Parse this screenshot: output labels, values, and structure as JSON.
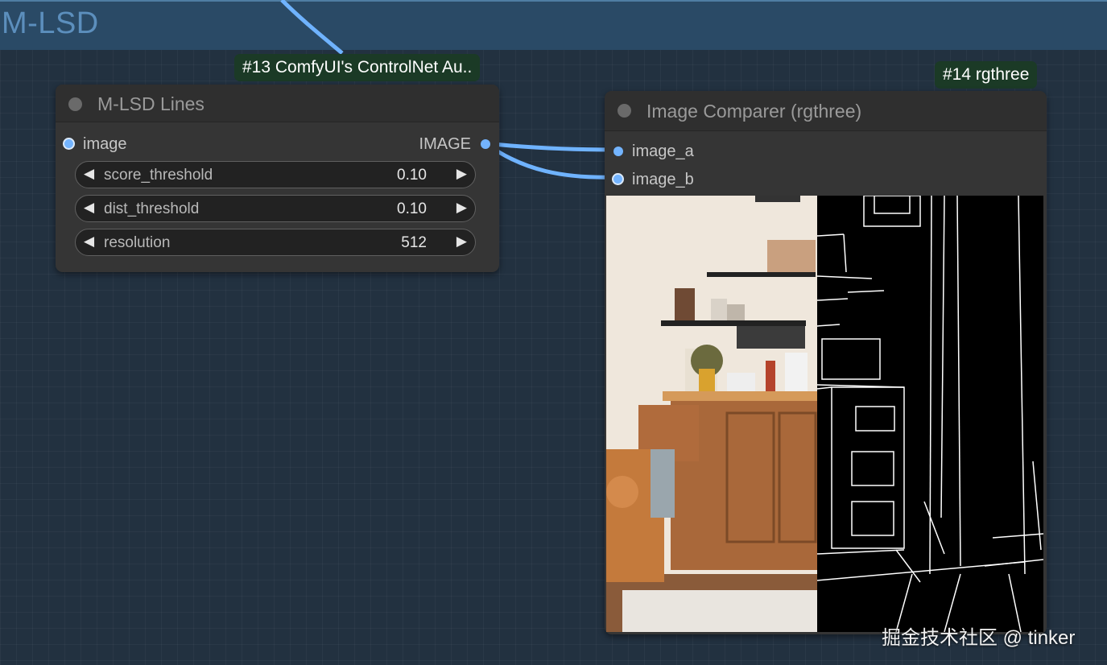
{
  "group": {
    "title": "M-LSD",
    "color": "#2a4a66"
  },
  "nodes": {
    "mlsd": {
      "badge": "#13 ComfyUI's ControlNet Au..",
      "title": "M-LSD Lines",
      "input_label": "image",
      "output_label": "IMAGE",
      "widgets": [
        {
          "label": "score_threshold",
          "value": "0.10"
        },
        {
          "label": "dist_threshold",
          "value": "0.10"
        },
        {
          "label": "resolution",
          "value": "512"
        }
      ]
    },
    "comparer": {
      "badge": "#14 rgthree",
      "title": "Image Comparer (rgthree)",
      "inputs": [
        "image_a",
        "image_b"
      ]
    }
  },
  "icons": {
    "decrement": "◀",
    "increment": "▶"
  },
  "colors": {
    "link": "#6fb3ff",
    "badge_bg": "#1b3a26",
    "node_bg": "#353535",
    "canvas_bg": "#223140"
  },
  "watermark": "掘金技术社区 @ tinker"
}
